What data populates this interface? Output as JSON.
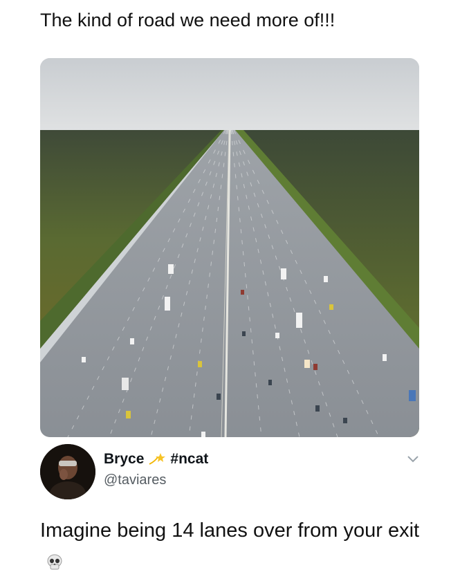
{
  "caption": "The kind of road we need more of!!!",
  "photo": {
    "subject": "aerial view of a very wide multi-lane highway through forest"
  },
  "tweet": {
    "display_name": "Bryce",
    "name_emoji": "dizzy-star-emoji",
    "hashtag": "#ncat",
    "handle": "@taviares",
    "text": "Imagine being 14 lanes over from your exit",
    "text_emoji": "skull-emoji",
    "menu_icon": "chevron-down-icon"
  },
  "colors": {
    "background": "#ffffff",
    "text": "#111111",
    "handle": "#555c62",
    "chevron": "#9aa3ab"
  }
}
